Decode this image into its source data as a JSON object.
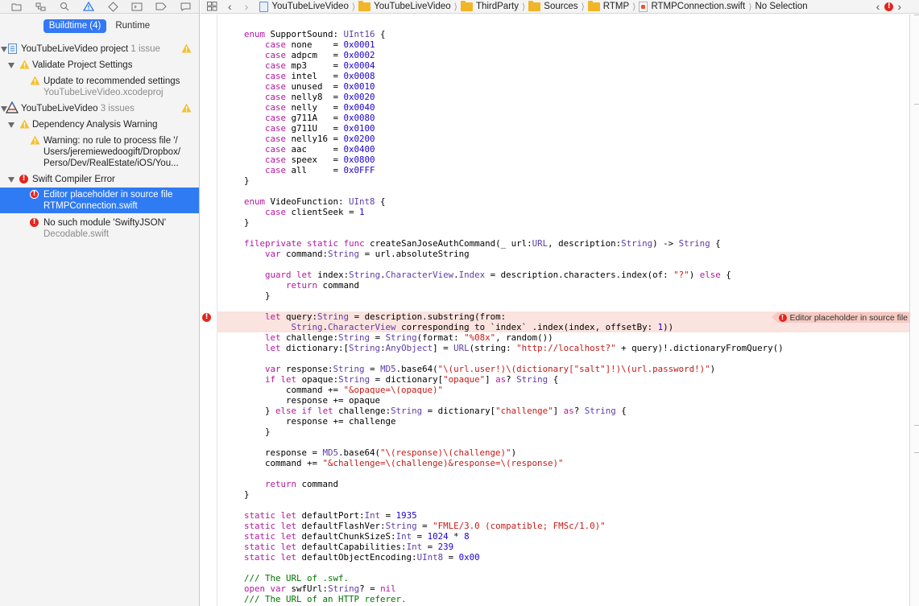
{
  "navigator": {
    "toolbar_icons": [
      "folder-icon",
      "hierarchy-icon",
      "search-icon",
      "issue-warning-icon",
      "test-diamond-icon",
      "debug-icon",
      "breakpoint-icon",
      "report-icon"
    ],
    "segments": [
      "Buildtime (4)",
      "Runtime"
    ],
    "rows": [
      {
        "kind": "project",
        "label": "YouTubeLiveVideo project",
        "extra": "1 issue",
        "warning": true
      },
      {
        "kind": "group",
        "label": "Validate Project Settings"
      },
      {
        "kind": "warning",
        "label": "Update to recommended settings",
        "sub": "YouTubeLiveVideo.xcodeproj"
      },
      {
        "kind": "target",
        "label": "YouTubeLiveVideo",
        "extra": "3 issues",
        "warning": true
      },
      {
        "kind": "group",
        "label": "Dependency Analysis Warning"
      },
      {
        "kind": "warning",
        "lines": [
          "Warning: no rule to process file '/",
          "Users/jeremiewedoogift/Dropbox/",
          "Perso/Dev/RealEstate/iOS/You..."
        ]
      },
      {
        "kind": "group-error",
        "label": "Swift Compiler Error"
      },
      {
        "kind": "error-selected",
        "label": "Editor placeholder in source file",
        "sub": "RTMPConnection.swift"
      },
      {
        "kind": "error",
        "label": "No such module 'SwiftyJSON'",
        "sub": "Decodable.swift"
      }
    ]
  },
  "jumpbar": {
    "crumbs": [
      "YouTubeLiveVideo",
      "YouTubeLiveVideo",
      "ThirdParty",
      "Sources",
      "RTMP",
      "RTMPConnection.swift",
      "No Selection"
    ]
  },
  "editor": {
    "error_banner": "Editor placeholder in source file",
    "code_lines": [
      "",
      "enum SupportSound: UInt16 {",
      "    case none    = 0x0001",
      "    case adpcm   = 0x0002",
      "    case mp3     = 0x0004",
      "    case intel   = 0x0008",
      "    case unused  = 0x0010",
      "    case nelly8  = 0x0020",
      "    case nelly   = 0x0040",
      "    case g711A   = 0x0080",
      "    case g711U   = 0x0100",
      "    case nelly16 = 0x0200",
      "    case aac     = 0x0400",
      "    case speex   = 0x0800",
      "    case all     = 0x0FFF",
      "}",
      "",
      "enum VideoFunction: UInt8 {",
      "    case clientSeek = 1",
      "}",
      "",
      "fileprivate static func createSanJoseAuthCommand(_ url:URL, description:String) -> String {",
      "    var command:String = url.absoluteString",
      "",
      "    guard let index:String.CharacterView.Index = description.characters.index(of: \"?\") else {",
      "        return command",
      "    }",
      "",
      "    let query:String = description.substring(from:",
      "         String.CharacterView corresponding to `index` .index(index, offsetBy: 1))",
      "    let challenge:String = String(format: \"%08x\", random())",
      "    let dictionary:[String:AnyObject] = URL(string: \"http://localhost?\" + query)!.dictionaryFromQuery()",
      "",
      "    var response:String = MD5.base64(\"\\(url.user!)\\(dictionary[\"salt\"]!)\\(url.password!)\")",
      "    if let opaque:String = dictionary[\"opaque\"] as? String {",
      "        command += \"&opaque=\\(opaque)\"",
      "        response += opaque",
      "    } else if let challenge:String = dictionary[\"challenge\"] as? String {",
      "        response += challenge",
      "    }",
      "",
      "    response = MD5.base64(\"\\(response)\\(challenge)\")",
      "    command += \"&challenge=\\(challenge)&response=\\(response)\"",
      "",
      "    return command",
      "}",
      "",
      "static let defaultPort:Int = 1935",
      "static let defaultFlashVer:String = \"FMLE/3.0 (compatible; FMSc/1.0)\"",
      "static let defaultChunkSizeS:Int = 1024 * 8",
      "static let defaultCapabilities:Int = 239",
      "static let defaultObjectEncoding:UInt8 = 0x00",
      "",
      "/// The URL of .swf.",
      "open var swfUrl:String? = nil",
      "/// The URL of an HTTP referer."
    ]
  }
}
